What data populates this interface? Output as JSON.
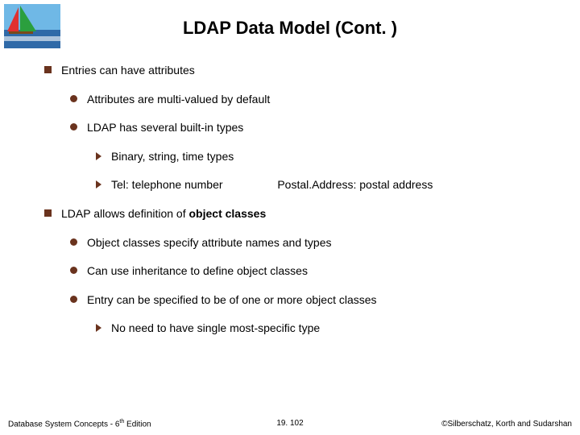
{
  "title": "LDAP Data Model (Cont. )",
  "bullets": {
    "b1": "Entries can have attributes",
    "b1_1": "Attributes are multi-valued by default",
    "b1_2": "LDAP has several built-in types",
    "b1_2_1": "Binary, string, time types",
    "b1_2_2a": "Tel:   telephone number",
    "b1_2_2b": "Postal.Address:  postal address",
    "b2a": "LDAP allows definition of ",
    "b2b": "object classes",
    "b2_1": "Object classes specify attribute names and types",
    "b2_2": "Can use inheritance to define object classes",
    "b2_3": "Entry can be specified to be of one or more object classes",
    "b2_3_1": "No need to have single most-specific type"
  },
  "footer": {
    "left_a": "Database System Concepts - 6",
    "left_b": " Edition",
    "center": "19. 102",
    "right": "©Silberschatz, Korth and Sudarshan"
  }
}
